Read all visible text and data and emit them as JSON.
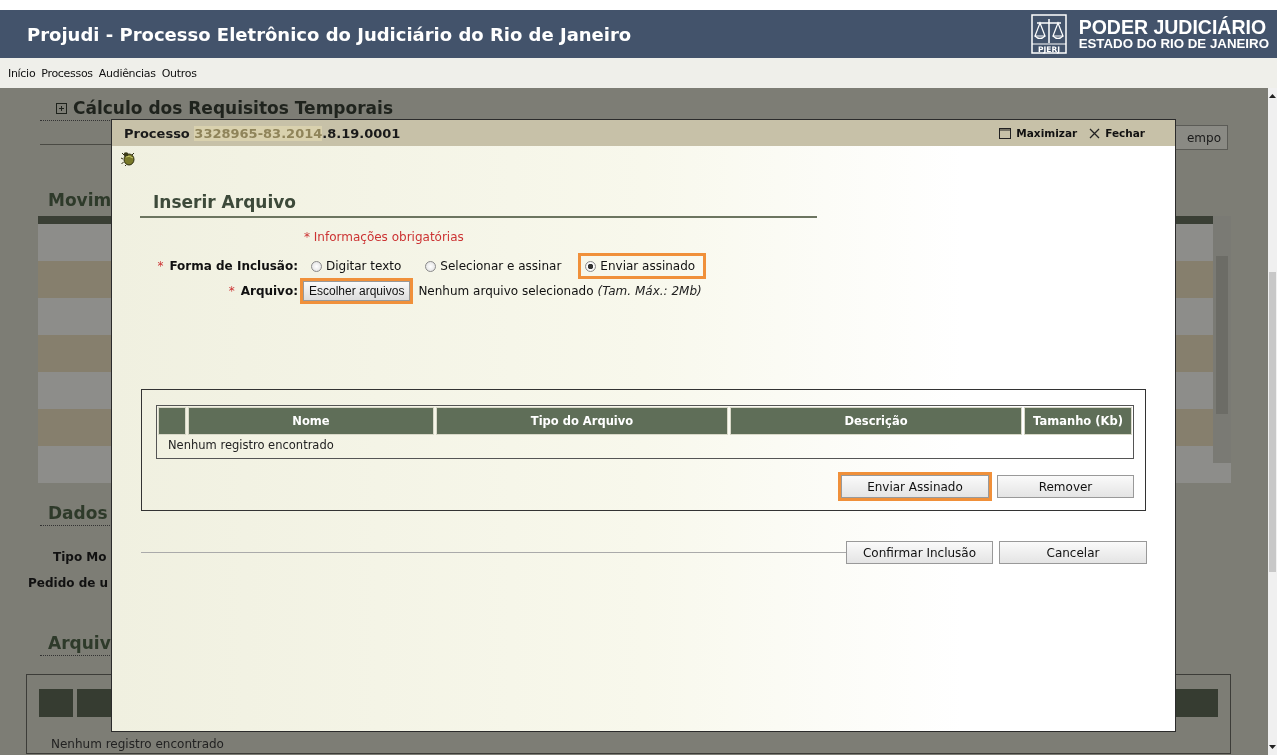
{
  "header": {
    "title": "Projudi - Processo Eletrônico do Judiciário do Rio de Janeiro",
    "logo_label": "PJERJ",
    "org_name": "PODER JUDICIÁRIO",
    "org_subtitle": "ESTADO DO RIO DE JANEIRO"
  },
  "menu": [
    {
      "label": "Início"
    },
    {
      "label": "Processos"
    },
    {
      "label": "Audiências"
    },
    {
      "label": "Outros"
    }
  ],
  "background": {
    "calc_title": "Cálculo dos Requisitos Temporais",
    "cut_button": "empo",
    "movements_heading": "Movim",
    "data_heading": "Dados",
    "field_labels": [
      "Tipo Mo",
      "Pedido de u"
    ],
    "files_heading": "Arquiv",
    "files_empty": "Nenhum registro encontrado"
  },
  "dialog": {
    "title_label": "Processo",
    "number_masked": "3328965-83.2014",
    "number_rest": ".8.19.0001",
    "actions": [
      {
        "label": "Maximizar",
        "kind": "maximize"
      },
      {
        "label": "Fechar",
        "kind": "close"
      }
    ],
    "heading": "Inserir Arquivo",
    "required_note": "* Informações obrigatórias",
    "inclusion": {
      "required_mark": "*",
      "label": "Forma de Inclusão:",
      "options": [
        {
          "label": "Digitar texto",
          "selected": false,
          "highlighted": false
        },
        {
          "label": "Selecionar e assinar",
          "selected": false,
          "highlighted": false
        },
        {
          "label": "Enviar assinado",
          "selected": true,
          "highlighted": true
        }
      ]
    },
    "file": {
      "required_mark": "*",
      "label": "Arquivo:",
      "button": "Escolher arquivos",
      "button_highlighted": true,
      "status": "Nenhum arquivo selecionado",
      "hint": "(Tam. Máx.: 2Mb)"
    },
    "table": {
      "columns": [
        "Nome",
        "Tipo do Arquivo",
        "Descrição",
        "Tamanho (Kb)"
      ],
      "empty_text": "Nenhum registro encontrado",
      "buttons": [
        {
          "label": "Enviar Assinado",
          "highlighted": true
        },
        {
          "label": "Remover",
          "highlighted": false
        }
      ]
    },
    "footer_buttons": [
      {
        "label": "Confirmar Inclusão"
      },
      {
        "label": "Cancelar"
      }
    ]
  }
}
